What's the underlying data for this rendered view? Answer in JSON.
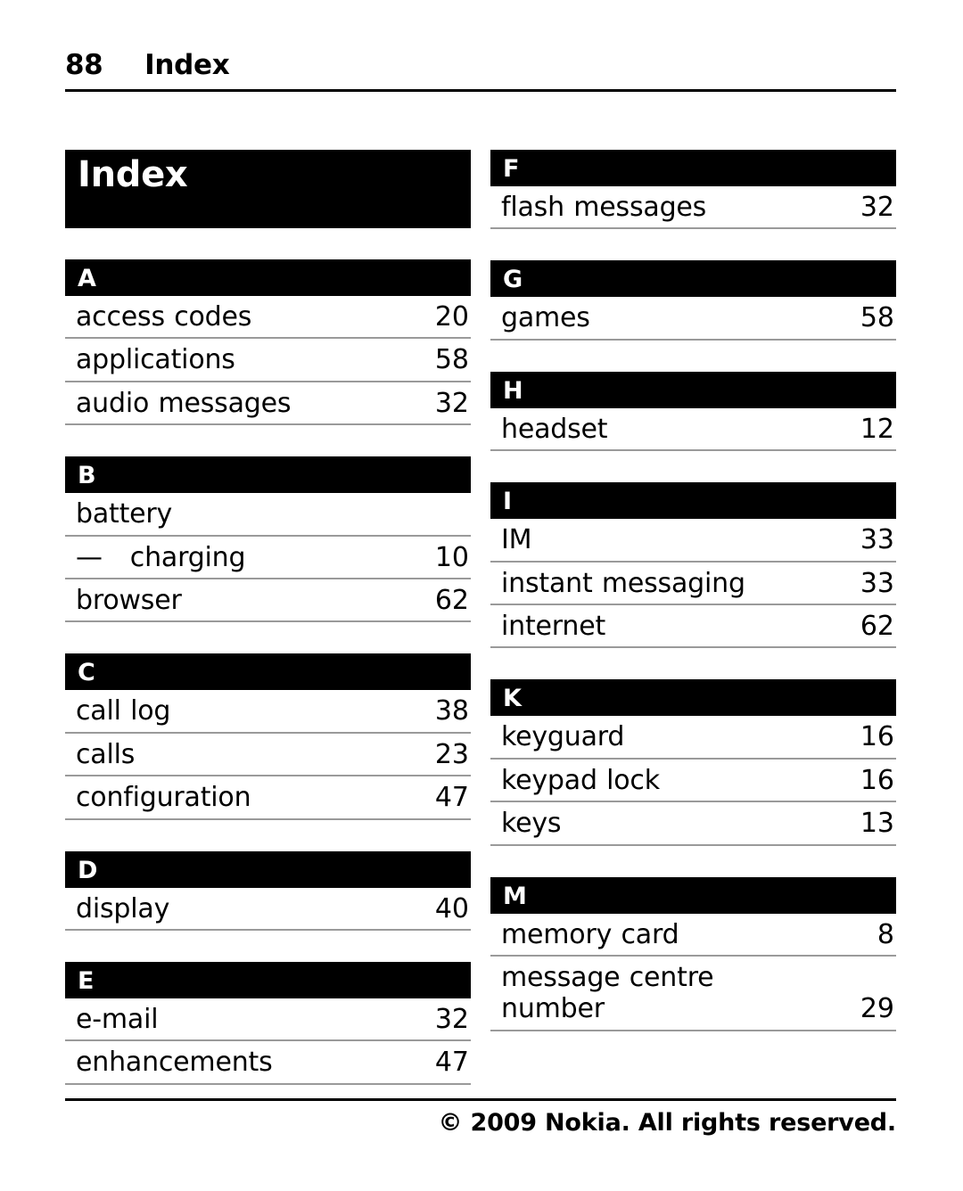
{
  "running_head": {
    "folio": "88",
    "title": "Index"
  },
  "index_title": "Index",
  "columns": [
    {
      "sections": [
        {
          "letter": "A",
          "entries": [
            {
              "label": "access codes",
              "page": "20"
            },
            {
              "label": "applications",
              "page": "58"
            },
            {
              "label": "audio messages",
              "page": "32"
            }
          ]
        },
        {
          "letter": "B",
          "entries": [
            {
              "label": "battery",
              "page": ""
            },
            {
              "label": "—   charging",
              "page": "10"
            },
            {
              "label": "browser",
              "page": "62"
            }
          ]
        },
        {
          "letter": "C",
          "entries": [
            {
              "label": "call log",
              "page": "38"
            },
            {
              "label": "calls",
              "page": "23"
            },
            {
              "label": "configuration",
              "page": "47"
            }
          ]
        },
        {
          "letter": "D",
          "entries": [
            {
              "label": "display",
              "page": "40"
            }
          ]
        },
        {
          "letter": "E",
          "entries": [
            {
              "label": "e-mail",
              "page": "32"
            },
            {
              "label": "enhancements",
              "page": "47"
            }
          ]
        }
      ]
    },
    {
      "sections": [
        {
          "letter": "F",
          "entries": [
            {
              "label": "flash messages",
              "page": "32"
            }
          ]
        },
        {
          "letter": "G",
          "entries": [
            {
              "label": "games",
              "page": "58"
            }
          ]
        },
        {
          "letter": "H",
          "entries": [
            {
              "label": "headset",
              "page": "12"
            }
          ]
        },
        {
          "letter": "I",
          "entries": [
            {
              "label": "IM",
              "page": "33"
            },
            {
              "label": "instant messaging",
              "page": "33"
            },
            {
              "label": "internet",
              "page": "62"
            }
          ]
        },
        {
          "letter": "K",
          "entries": [
            {
              "label": "keyguard",
              "page": "16"
            },
            {
              "label": "keypad lock",
              "page": "16"
            },
            {
              "label": "keys",
              "page": "13"
            }
          ]
        },
        {
          "letter": "M",
          "entries": [
            {
              "label": "memory card",
              "page": "8"
            },
            {
              "label": "message centre number",
              "page": "29",
              "wrap": true
            }
          ]
        }
      ]
    }
  ],
  "footer": {
    "copyright": "© 2009 Nokia. All rights reserved."
  },
  "colors": {
    "banner_background": "#000000",
    "banner_text": "#ffffff",
    "entry_rule": "#9a9a9a",
    "page_background": "#ffffff",
    "body_text": "#000000"
  }
}
